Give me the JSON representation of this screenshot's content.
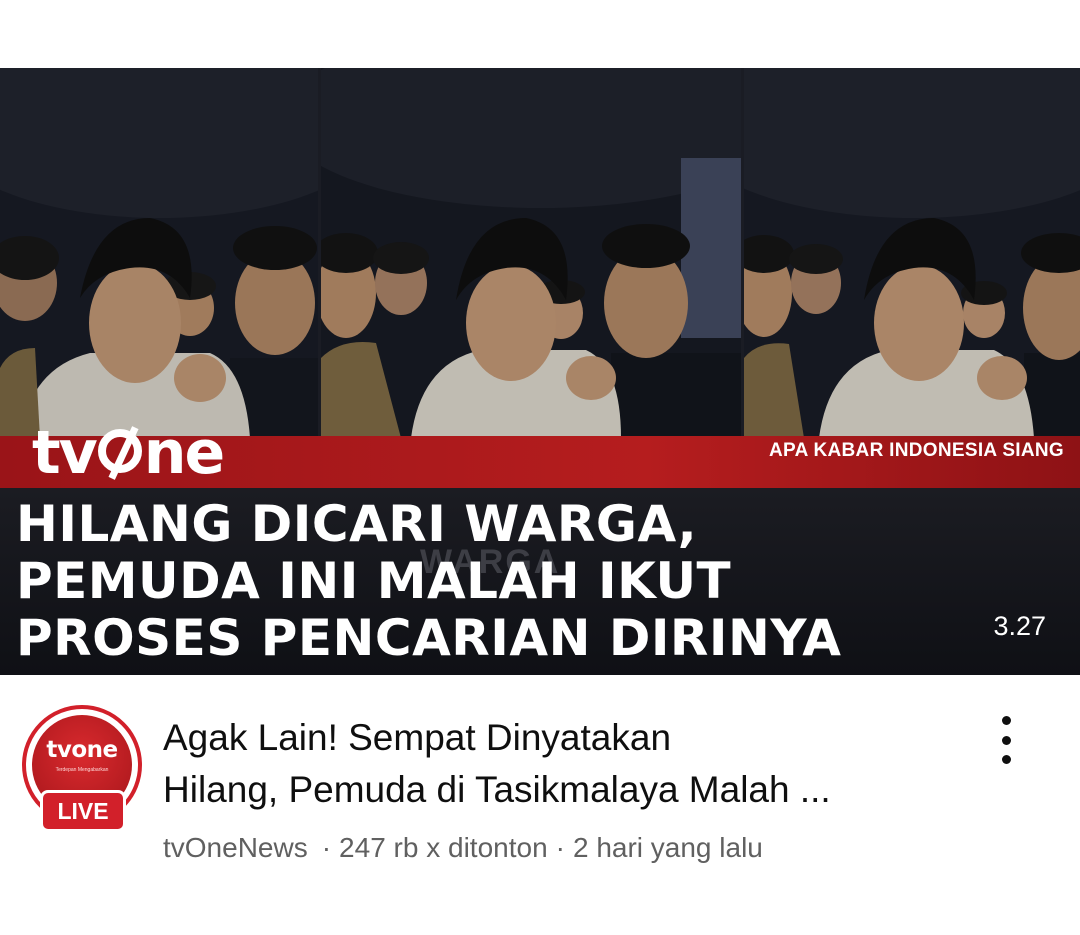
{
  "thumbnail": {
    "logo_text": "tvone",
    "program_name": "APA KABAR INDONESIA SIANG",
    "headline_lines": [
      "HILANG DICARI WARGA,",
      "PEMUDA INI MALAH IKUT",
      "PROSES PENCARIAN DIRINYA"
    ],
    "ghost_text": "WARGA",
    "duration": "3.27"
  },
  "channel": {
    "avatar_logo": "tvone",
    "avatar_tagline": "Terdepan Mengabarkan",
    "live_label": "LIVE",
    "name": "tvOneNews"
  },
  "video": {
    "title_lines": [
      "Agak Lain! Sempat Dinyatakan",
      "Hilang, Pemuda di Tasikmalaya Malah ..."
    ],
    "views": "247 rb x ditonton",
    "age": "2 hari yang lalu",
    "separator": "·"
  },
  "colors": {
    "brand_red": "#d2202a",
    "band_red": "#b51d1e",
    "text_primary": "#0f0f0f",
    "text_secondary": "#606060"
  },
  "icons": {
    "more": "more-vert-icon"
  }
}
